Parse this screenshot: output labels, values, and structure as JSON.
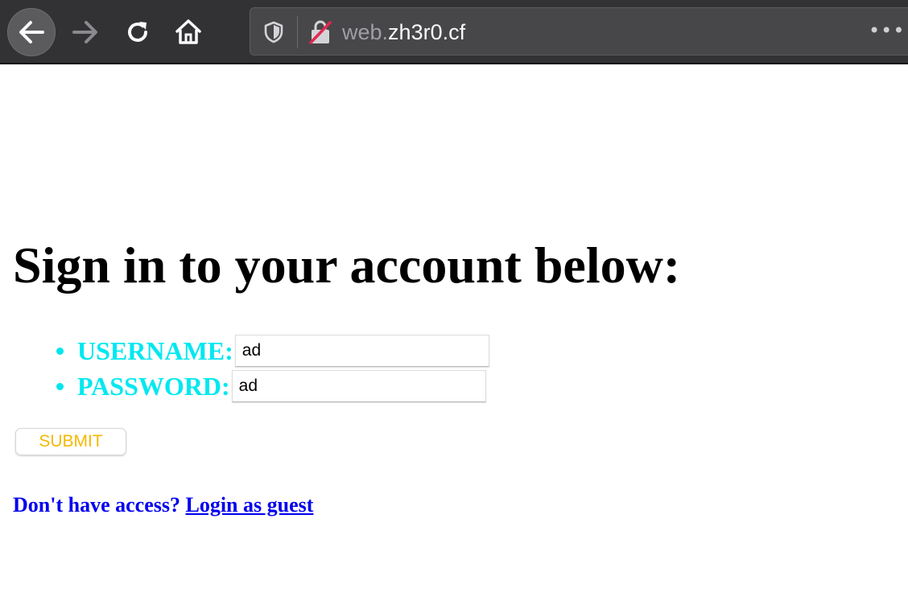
{
  "browser": {
    "url_prefix": "web.",
    "url_domain": "zh3r0.cf",
    "more_menu": "•••"
  },
  "page": {
    "title": "Sign in to your account below:",
    "fields": [
      {
        "label": "USERNAME:",
        "value": "ad"
      },
      {
        "label": "PASSWORD:",
        "value": "ad"
      }
    ],
    "submit_label": "SUBMIT",
    "guest_prompt": "Don't have access?",
    "guest_link": "Login as guest"
  },
  "colors": {
    "label": "#00e8f0",
    "submit_text": "#f5b800",
    "link": "#0000ee"
  }
}
